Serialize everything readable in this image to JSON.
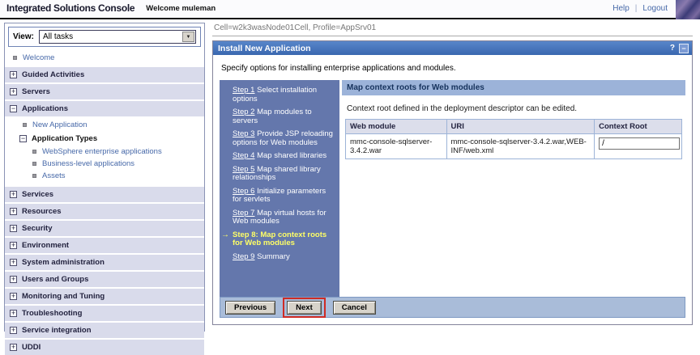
{
  "header": {
    "app_title": "Integrated Solutions Console",
    "welcome": "Welcome muleman",
    "help": "Help",
    "divider": "|",
    "logout": "Logout"
  },
  "sidebar": {
    "view_label": "View:",
    "view_value": "All tasks",
    "welcome": "Welcome",
    "sections_top": [
      "Guided Activities",
      "Servers"
    ],
    "applications": {
      "label": "Applications",
      "new_application": "New Application",
      "application_types": "Application Types",
      "children": [
        "WebSphere enterprise applications",
        "Business-level applications",
        "Assets"
      ]
    },
    "sections_bottom": [
      "Services",
      "Resources",
      "Security",
      "Environment",
      "System administration",
      "Users and Groups",
      "Monitoring and Tuning",
      "Troubleshooting",
      "Service integration",
      "UDDI"
    ]
  },
  "breadcrumb": "Cell=w2k3wasNode01Cell, Profile=AppSrv01",
  "portlet": {
    "title": "Install New Application",
    "help_icon": "?",
    "minimize_icon": "−",
    "intro": "Specify options for installing enterprise applications and modules."
  },
  "steps": [
    {
      "num": "Step 1",
      "label": "Select installation options"
    },
    {
      "num": "Step 2",
      "label": "Map modules to servers"
    },
    {
      "num": "Step 3",
      "label": "Provide JSP reloading options for Web modules"
    },
    {
      "num": "Step 4",
      "label": "Map shared libraries"
    },
    {
      "num": "Step 5",
      "label": "Map shared library relationships"
    },
    {
      "num": "Step 6",
      "label": "Initialize parameters for servlets"
    },
    {
      "num": "Step 7",
      "label": "Map virtual hosts for Web modules"
    },
    {
      "num": "Step 8:",
      "label": "Map context roots for Web modules",
      "current": true,
      "arrow": "→"
    },
    {
      "num": "Step 9",
      "label": "Summary"
    }
  ],
  "content": {
    "header": "Map context roots for Web modules",
    "description": "Context root defined in the deployment descriptor can be edited.",
    "table": {
      "headers": [
        "Web module",
        "URI",
        "Context Root"
      ],
      "rows": [
        {
          "web_module": "mmc-console-sqlserver-3.4.2.war",
          "uri": "mmc-console-sqlserver-3.4.2.war,WEB-INF/web.xml",
          "context_root": "/"
        }
      ]
    }
  },
  "buttons": {
    "previous": "Previous",
    "next": "Next",
    "cancel": "Cancel"
  },
  "icons": {
    "expand": "+",
    "collapse": "−",
    "dropdown_arrow": "▼"
  },
  "colors": {
    "title_bar_blue": "#3f6db6",
    "steps_panel_blue": "#6477ac",
    "current_step_yellow": "#ffff66",
    "content_header_blue": "#9cb3d9",
    "footer_strip_blue": "#a9bcd9",
    "section_lavender": "#d9dbeb",
    "link_blue": "#4668a8",
    "annotation_red": "#cf2b24"
  }
}
